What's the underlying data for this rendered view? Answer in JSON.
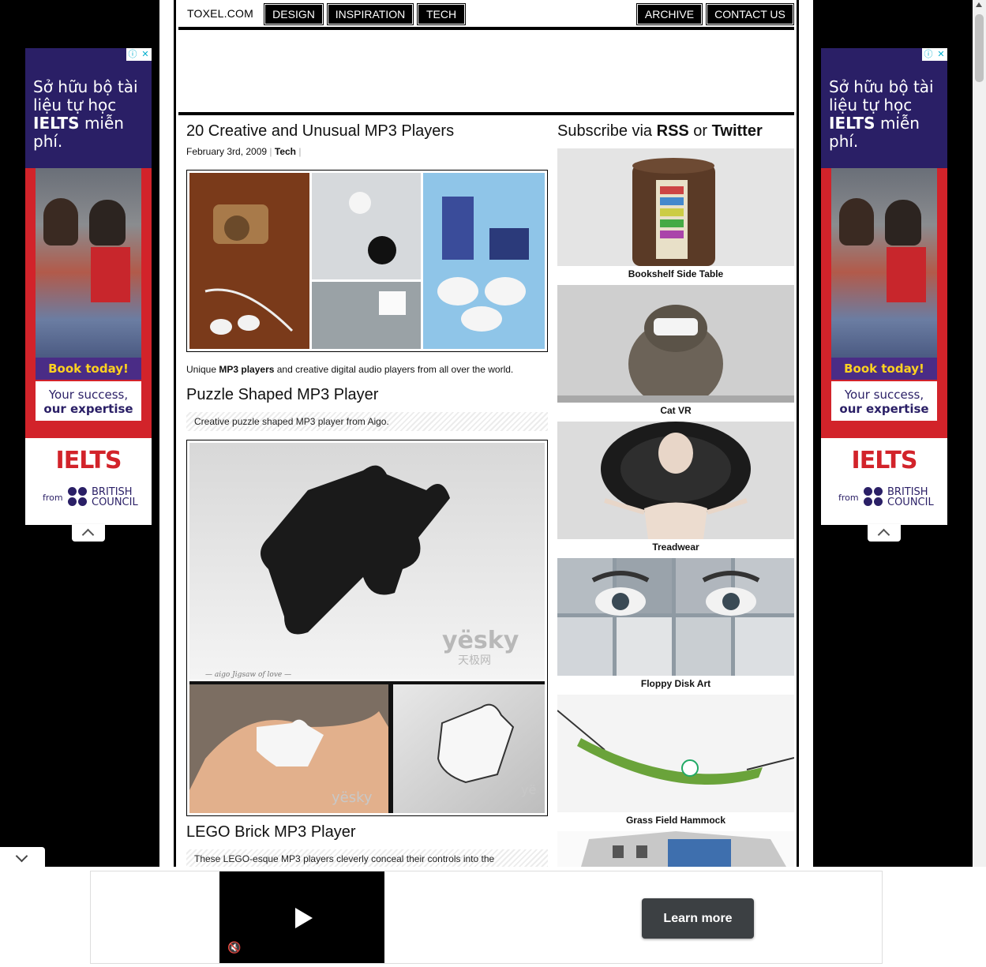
{
  "nav": {
    "logo": "TOXEL.COM",
    "left_items": [
      "DESIGN",
      "INSPIRATION",
      "TECH"
    ],
    "right_items": [
      "ARCHIVE",
      "CONTACT US"
    ]
  },
  "post": {
    "title": "20 Creative and Unusual MP3 Players",
    "date": "February 3rd, 2009",
    "separator": "|",
    "category": "Tech",
    "intro_prefix": "Unique ",
    "intro_bold": "MP3 players",
    "intro_suffix": " and creative digital audio players from all over the world.",
    "sections": [
      {
        "title": "Puzzle Shaped MP3 Player",
        "desc": "Creative puzzle shaped MP3 player from Aigo.",
        "watermark": "yësky",
        "watermark_sub": "天极网",
        "caption": "— aigo Jigsaw of love —"
      },
      {
        "title": "LEGO Brick MP3 Player",
        "desc": "These LEGO-esque MP3 players cleverly conceal their controls into the"
      }
    ]
  },
  "sidebar": {
    "title_prefix": "Subscribe via ",
    "rss": "RSS",
    "or": " or ",
    "twitter": "Twitter",
    "items": [
      {
        "caption": "Bookshelf Side Table"
      },
      {
        "caption": "Cat VR"
      },
      {
        "caption": "Treadwear"
      },
      {
        "caption": "Floppy Disk Art"
      },
      {
        "caption": "Grass Field Hammock"
      }
    ]
  },
  "side_ad": {
    "line1": "Sở hữu bộ tài",
    "line2": "liệu tự học",
    "line3_bold": "IELTS",
    "line3_rest": " miễn phí.",
    "book_btn": "Book today!",
    "success_1": "Your success,",
    "success_2": "our expertise",
    "brand": "IELTS",
    "from": "from",
    "bc_1": "BRITISH",
    "bc_2": "COUNCIL"
  },
  "bottom_ad": {
    "button": "Learn more"
  },
  "colors": {
    "ad_purple": "#2a1f66",
    "ad_red": "#d2232a",
    "ad_yellow": "#ffd21f"
  }
}
